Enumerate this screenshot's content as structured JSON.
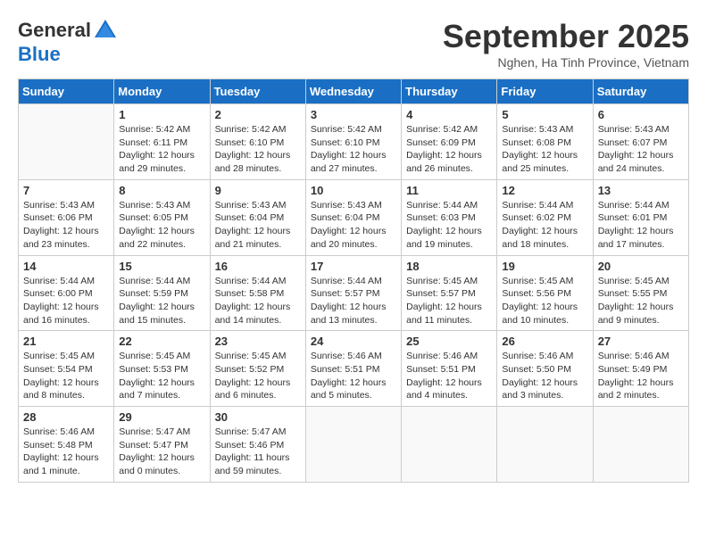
{
  "header": {
    "logo_general": "General",
    "logo_blue": "Blue",
    "month_title": "September 2025",
    "location": "Nghen, Ha Tinh Province, Vietnam"
  },
  "weekdays": [
    "Sunday",
    "Monday",
    "Tuesday",
    "Wednesday",
    "Thursday",
    "Friday",
    "Saturday"
  ],
  "weeks": [
    [
      {
        "day": "",
        "info": ""
      },
      {
        "day": "1",
        "info": "Sunrise: 5:42 AM\nSunset: 6:11 PM\nDaylight: 12 hours\nand 29 minutes."
      },
      {
        "day": "2",
        "info": "Sunrise: 5:42 AM\nSunset: 6:10 PM\nDaylight: 12 hours\nand 28 minutes."
      },
      {
        "day": "3",
        "info": "Sunrise: 5:42 AM\nSunset: 6:10 PM\nDaylight: 12 hours\nand 27 minutes."
      },
      {
        "day": "4",
        "info": "Sunrise: 5:42 AM\nSunset: 6:09 PM\nDaylight: 12 hours\nand 26 minutes."
      },
      {
        "day": "5",
        "info": "Sunrise: 5:43 AM\nSunset: 6:08 PM\nDaylight: 12 hours\nand 25 minutes."
      },
      {
        "day": "6",
        "info": "Sunrise: 5:43 AM\nSunset: 6:07 PM\nDaylight: 12 hours\nand 24 minutes."
      }
    ],
    [
      {
        "day": "7",
        "info": "Sunrise: 5:43 AM\nSunset: 6:06 PM\nDaylight: 12 hours\nand 23 minutes."
      },
      {
        "day": "8",
        "info": "Sunrise: 5:43 AM\nSunset: 6:05 PM\nDaylight: 12 hours\nand 22 minutes."
      },
      {
        "day": "9",
        "info": "Sunrise: 5:43 AM\nSunset: 6:04 PM\nDaylight: 12 hours\nand 21 minutes."
      },
      {
        "day": "10",
        "info": "Sunrise: 5:43 AM\nSunset: 6:04 PM\nDaylight: 12 hours\nand 20 minutes."
      },
      {
        "day": "11",
        "info": "Sunrise: 5:44 AM\nSunset: 6:03 PM\nDaylight: 12 hours\nand 19 minutes."
      },
      {
        "day": "12",
        "info": "Sunrise: 5:44 AM\nSunset: 6:02 PM\nDaylight: 12 hours\nand 18 minutes."
      },
      {
        "day": "13",
        "info": "Sunrise: 5:44 AM\nSunset: 6:01 PM\nDaylight: 12 hours\nand 17 minutes."
      }
    ],
    [
      {
        "day": "14",
        "info": "Sunrise: 5:44 AM\nSunset: 6:00 PM\nDaylight: 12 hours\nand 16 minutes."
      },
      {
        "day": "15",
        "info": "Sunrise: 5:44 AM\nSunset: 5:59 PM\nDaylight: 12 hours\nand 15 minutes."
      },
      {
        "day": "16",
        "info": "Sunrise: 5:44 AM\nSunset: 5:58 PM\nDaylight: 12 hours\nand 14 minutes."
      },
      {
        "day": "17",
        "info": "Sunrise: 5:44 AM\nSunset: 5:57 PM\nDaylight: 12 hours\nand 13 minutes."
      },
      {
        "day": "18",
        "info": "Sunrise: 5:45 AM\nSunset: 5:57 PM\nDaylight: 12 hours\nand 11 minutes."
      },
      {
        "day": "19",
        "info": "Sunrise: 5:45 AM\nSunset: 5:56 PM\nDaylight: 12 hours\nand 10 minutes."
      },
      {
        "day": "20",
        "info": "Sunrise: 5:45 AM\nSunset: 5:55 PM\nDaylight: 12 hours\nand 9 minutes."
      }
    ],
    [
      {
        "day": "21",
        "info": "Sunrise: 5:45 AM\nSunset: 5:54 PM\nDaylight: 12 hours\nand 8 minutes."
      },
      {
        "day": "22",
        "info": "Sunrise: 5:45 AM\nSunset: 5:53 PM\nDaylight: 12 hours\nand 7 minutes."
      },
      {
        "day": "23",
        "info": "Sunrise: 5:45 AM\nSunset: 5:52 PM\nDaylight: 12 hours\nand 6 minutes."
      },
      {
        "day": "24",
        "info": "Sunrise: 5:46 AM\nSunset: 5:51 PM\nDaylight: 12 hours\nand 5 minutes."
      },
      {
        "day": "25",
        "info": "Sunrise: 5:46 AM\nSunset: 5:51 PM\nDaylight: 12 hours\nand 4 minutes."
      },
      {
        "day": "26",
        "info": "Sunrise: 5:46 AM\nSunset: 5:50 PM\nDaylight: 12 hours\nand 3 minutes."
      },
      {
        "day": "27",
        "info": "Sunrise: 5:46 AM\nSunset: 5:49 PM\nDaylight: 12 hours\nand 2 minutes."
      }
    ],
    [
      {
        "day": "28",
        "info": "Sunrise: 5:46 AM\nSunset: 5:48 PM\nDaylight: 12 hours\nand 1 minute."
      },
      {
        "day": "29",
        "info": "Sunrise: 5:47 AM\nSunset: 5:47 PM\nDaylight: 12 hours\nand 0 minutes."
      },
      {
        "day": "30",
        "info": "Sunrise: 5:47 AM\nSunset: 5:46 PM\nDaylight: 11 hours\nand 59 minutes."
      },
      {
        "day": "",
        "info": ""
      },
      {
        "day": "",
        "info": ""
      },
      {
        "day": "",
        "info": ""
      },
      {
        "day": "",
        "info": ""
      }
    ]
  ]
}
